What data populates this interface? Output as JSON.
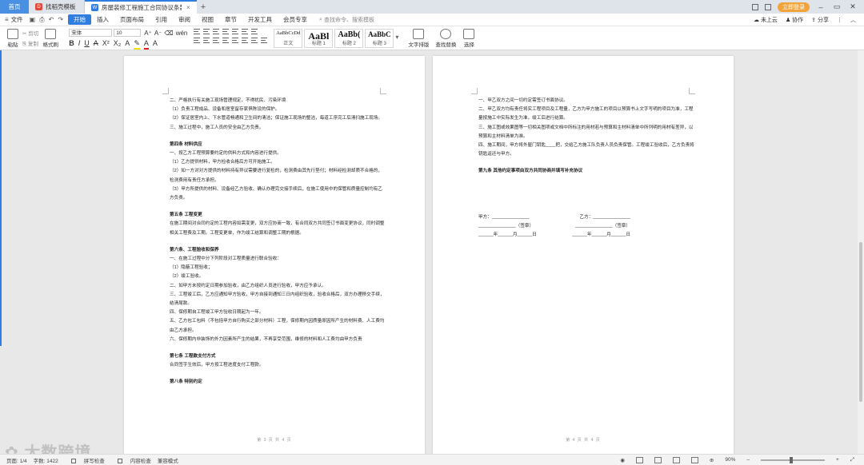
{
  "tabs": {
    "home": "首页",
    "template": "找稻壳模板",
    "document": "房屋装修工程施工合同协议条款",
    "new_tab": "+"
  },
  "titlebar": {
    "login": "立即登录"
  },
  "menu": {
    "file": "文件",
    "items": [
      "开始",
      "插入",
      "页面布局",
      "引用",
      "审阅",
      "视图",
      "章节",
      "开发工具",
      "会员专享"
    ],
    "search": "查找命令、搜索模板",
    "right": [
      "未上云",
      "协作",
      "分享"
    ]
  },
  "ribbon": {
    "paste": "粘贴",
    "cut": "剪切",
    "copy": "复制",
    "format_painter": "格式刷",
    "font_name": "宋体",
    "font_size": "10",
    "styles": [
      {
        "preview": "AaBbCcDd",
        "label": "正文"
      },
      {
        "preview": "AaBl",
        "label": "标题 1"
      },
      {
        "preview": "AaBb(",
        "label": "标题 2"
      },
      {
        "preview": "AaBbC",
        "label": "标题 3"
      }
    ],
    "text_layout": "文字排版",
    "find_replace": "查找替换",
    "select": "选择"
  },
  "page1": {
    "lines": [
      "二、严格执行有关施工现场管理规定，不得扰民、污染环境",
      "（1）负责工程成品、设备和居室留存家俱陈设的保护。",
      "（2）保证居室内上、下水管道畅通和卫生间的清洁；保证施工现场的整洁，每道工序完工后清扫施工现场。",
      "三、施工过程中，施工人员的安全由乙方负责。"
    ],
    "section4_title": "第四条  材料供应",
    "section4": [
      "一、按乙方工程预算要约定的供料方式和内容进行提供。",
      "（1）乙方提供材料，甲方检收合格后方可开始施工。",
      "（2）如一方对对方提供的材料持有异议需要进行复检的，检测费由其先行垫付；材料经检测却质不合格的，检测费用有责任方承担。",
      "（3）甲方所提供的材料、设备经乙方验收、确认办理完交接手续后，在施工使用中的保管和质量控制均有乙方负责。"
    ],
    "section5_title": "第五条  工程变更",
    "section5": [
      "在施工期间对合同约定的工程内容如需变更，双方应协商一致，有合同双方共同签订书面变更协议，同时调整相关工程费及工期。工程变更单，作为竣工结算和调整工期的根据。"
    ],
    "section6_title": "第六条、工程验收和保养",
    "section6": [
      "一、在施工过程中分下列阶段对工程质量进行联合验收：",
      "（1）隐蔽工程验收；",
      "（2）竣工验收。",
      "二、如甲方未按约定日期参加验收，由乙方组织人员进行验收，甲方应予承认。",
      "三、工程竣工后，乙方应通知甲方验收，甲方自接到通知三日内组织验收，验收合格后，双方办理移交手续，结清尾款。",
      "四、保修期自工程竣工甲方验收日期起为一年。",
      "五、乙方包工包料（不包括甲方自行购买之部分材料）工程，保修期内因质量原因所产生的材料费、人工费均由乙方承担。",
      "六、保修期内非装饰的外力因素所产生的结果，不再享受范围，维修的材料和人工费均由甲方负责"
    ],
    "section7_title": "第七条    工程款支付方式",
    "section7": [
      "合同签字生效后，甲方按工程进度支付工程款。"
    ],
    "section8_title": "第八条    特别约定",
    "footer": "第 3 页 共 4 页"
  },
  "page2": {
    "lines": [
      "一、甲乙双方之间一切约定需签订书面协议。",
      "二、甲乙双方均有责任将实工程项目及工程量，乙方为甲方施工的项目以预算书上文字写明的项目为准，工程量按施工中实际发生为准，竣工后进行结算。",
      "三、施工图或效果图等一切相关图项或文档中所标注的用材若与预算和主材料清单中所列明的用材有差异，以预算和主材料清单为准。",
      "四、施工期间，甲方将外屋门钥匙____把，交给乙方施工队负责人员负责保管。工程竣工验收后，乙方负责将钥匙返还与甲方。"
    ],
    "section9_title": "第九条    其他约定事项由双方共同协商并填写补充协议",
    "sign_party_a": "甲方：_______________",
    "sign_party_b": "乙方：_______________",
    "sign_a": "_______________（签章）",
    "sign_b": "_______________（签章）",
    "date_a": "______年______月______日",
    "date_b": "______年______月______日",
    "footer": "第 4 页 共 4 页"
  },
  "status": {
    "page": "页面: 1/4",
    "words": "字数: 1422",
    "spell": "拼写检查",
    "content": "内容检查",
    "compat": "兼容模式",
    "zoom": "90%"
  },
  "watermark": "大数跨境"
}
